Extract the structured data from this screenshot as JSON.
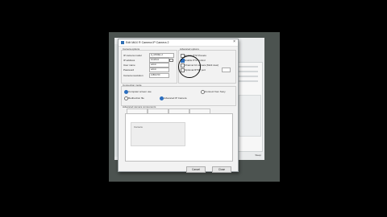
{
  "dialog": {
    "title": "Edit MAX R Camera IP Camera 2",
    "camera_group_label": "Camera options",
    "advanced_group_label": "Advanced options",
    "fields": [
      {
        "label": "IP camera model",
        "value": "Q_MODEL-2",
        "type": "select"
      },
      {
        "label": "IP address",
        "value": "localhost",
        "type": "input"
      },
      {
        "label": "User name",
        "value": "admin",
        "type": "input"
      },
      {
        "label": "Password",
        "value": "admin",
        "type": "input"
      },
      {
        "label": "Camera resolution",
        "value": "1280x720",
        "type": "select"
      }
    ],
    "advanced_options": [
      {
        "label": "Enable PTZ Presets",
        "checked": false
      },
      {
        "label": "Enable PTZ control",
        "checked": true
      },
      {
        "label": "Channel 10 camera (Multi view)",
        "checked": false
      },
      {
        "label": "Optional RTSP port",
        "checked": false
      }
    ],
    "connection_label": "Connection mode",
    "radio_options": [
      {
        "label": "Computer screen use",
        "checked": true
      },
      {
        "label": "Connect from Sony",
        "checked": false
      },
      {
        "label": "Redirection file",
        "checked": false
      },
      {
        "label": "Advanced IP Camera",
        "checked": true
      }
    ],
    "components_label": "Advanced camera components",
    "tabs": [
      "",
      "",
      "",
      ""
    ],
    "list_item": "Camera",
    "ok": "Close",
    "cancel": "Cancel"
  },
  "background_window": {
    "status": "Sleep"
  }
}
